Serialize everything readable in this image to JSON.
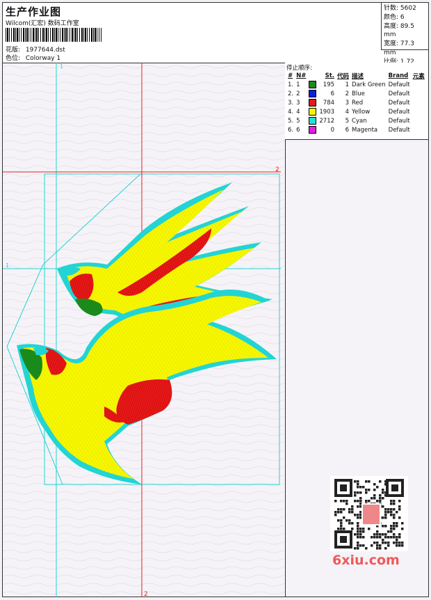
{
  "header": {
    "title": "生产作业图",
    "studio": "Wilcom(汇宏) 数码工作室",
    "design_label": "花版:",
    "design_value": "1977644.dst",
    "colorway_label": "色位:",
    "colorway_value": "Colorway 1"
  },
  "stats": [
    {
      "label": "针数:",
      "value": "5602"
    },
    {
      "label": "颜色:",
      "value": "6"
    },
    {
      "label": "高度:",
      "value": "89.5 mm"
    },
    {
      "label": "宽度:",
      "value": "77.3 mm"
    },
    {
      "label": "比例:",
      "value": "1.72"
    }
  ],
  "stop_sequence": {
    "title": "停止顺序:",
    "columns": [
      "#",
      "N#",
      "St.",
      "代码",
      "描述",
      "Brand",
      "元素"
    ],
    "rows": [
      {
        "n": "1.",
        "code": "1",
        "color": "#1a8a1a",
        "st": "195",
        "id": "1",
        "desc": "Dark Green",
        "brand": "Default"
      },
      {
        "n": "2.",
        "code": "2",
        "color": "#0a1ee0",
        "st": "6",
        "id": "2",
        "desc": "Blue",
        "brand": "Default"
      },
      {
        "n": "3.",
        "code": "3",
        "color": "#e81818",
        "st": "784",
        "id": "3",
        "desc": "Red",
        "brand": "Default"
      },
      {
        "n": "4.",
        "code": "4",
        "color": "#f5f500",
        "st": "1903",
        "id": "4",
        "desc": "Yellow",
        "brand": "Default"
      },
      {
        "n": "5.",
        "code": "5",
        "color": "#20e0d8",
        "st": "2712",
        "id": "5",
        "desc": "Cyan",
        "brand": "Default"
      },
      {
        "n": "6.",
        "code": "6",
        "color": "#e020e0",
        "st": "0",
        "id": "6",
        "desc": "Magenta",
        "brand": "Default"
      }
    ]
  },
  "canvas": {
    "marker_top_1": "1",
    "marker_left_1": "1",
    "marker_right_2": "2",
    "marker_bottom_2": "2",
    "colors": {
      "guide": "#22d4d4",
      "axis": "#e02020"
    }
  },
  "watermark": {
    "logo": "6xiu.com"
  }
}
